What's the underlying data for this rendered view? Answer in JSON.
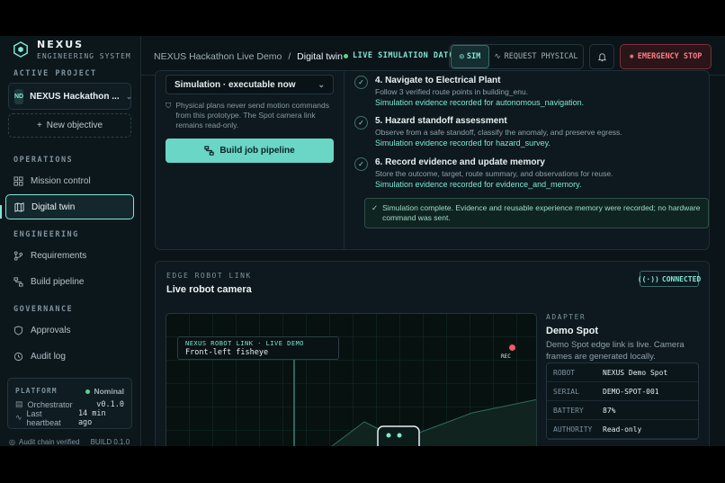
{
  "brand": {
    "name": "NEXUS",
    "subtitle": "ENGINEERING SYSTEM"
  },
  "sidebar": {
    "active_project_label": "ACTIVE PROJECT",
    "project": {
      "initials": "ND",
      "name": "NEXUS Hackathon ..."
    },
    "new_objective": "New objective",
    "sections": {
      "operations": "OPERATIONS",
      "engineering": "ENGINEERING",
      "governance": "GOVERNANCE"
    },
    "items": [
      {
        "label": "Mission control"
      },
      {
        "label": "Digital twin"
      },
      {
        "label": "Requirements"
      },
      {
        "label": "Build pipeline"
      },
      {
        "label": "Approvals"
      },
      {
        "label": "Audit log"
      }
    ],
    "platform": {
      "label": "PLATFORM",
      "status": "Nominal",
      "rows": [
        {
          "key": "Orchestrator",
          "value": "v0.1.0"
        },
        {
          "key": "Last heartbeat",
          "value": "14 min ago"
        }
      ]
    },
    "footer_left": "Audit chain verified",
    "footer_right": "BUILD 0.1.0"
  },
  "header": {
    "breadcrumb_parent": "NEXUS Hackathon Live Demo",
    "breadcrumb_sep": "/",
    "breadcrumb_current": "Digital twin",
    "live_label": "LIVE SIMULATION DATA",
    "sim_label": "SIM",
    "request_label": "REQUEST PHYSICAL",
    "estop_label": "EMERGENCY STOP"
  },
  "pipeline": {
    "select_value": "Simulation · executable now",
    "note": "Physical plans never send motion commands from this prototype. The Spot camera link remains read-only.",
    "build_label": "Build job pipeline",
    "steps": [
      {
        "title": "4. Navigate to Electrical Plant",
        "desc": "Follow 3 verified route points in building_enu.",
        "evidence": "Simulation evidence recorded for autonomous_navigation."
      },
      {
        "title": "5. Hazard standoff assessment",
        "desc": "Observe from a safe standoff, classify the anomaly, and preserve egress.",
        "evidence": "Simulation evidence recorded for hazard_survey."
      },
      {
        "title": "6. Record evidence and update memory",
        "desc": "Store the outcome, target, route summary, and observations for reuse.",
        "evidence": "Simulation evidence recorded for evidence_and_memory."
      }
    ],
    "complete_msg": "Simulation complete. Evidence and reusable experience memory were recorded; no hardware command was sent."
  },
  "robot_link": {
    "section_label": "EDGE ROBOT LINK",
    "title": "Live robot camera",
    "status": "CONNECTED",
    "overlay_line1": "NEXUS ROBOT LINK · LIVE DEMO",
    "overlay_line2": "Front-left fisheye",
    "rec_label": "REC",
    "adapter": {
      "label": "ADAPTER",
      "name": "Demo Spot",
      "desc": "Demo Spot edge link is live. Camera frames are generated locally.",
      "rows": [
        {
          "key": "ROBOT",
          "value": "NEXUS Demo Spot"
        },
        {
          "key": "SERIAL",
          "value": "DEMO-SPOT-001"
        },
        {
          "key": "BATTERY",
          "value": "87%"
        },
        {
          "key": "AUTHORITY",
          "value": "Read-only"
        }
      ]
    }
  },
  "colors": {
    "accent": "#7fe7d5",
    "danger": "#ff7b84",
    "background": "#0b1419"
  }
}
